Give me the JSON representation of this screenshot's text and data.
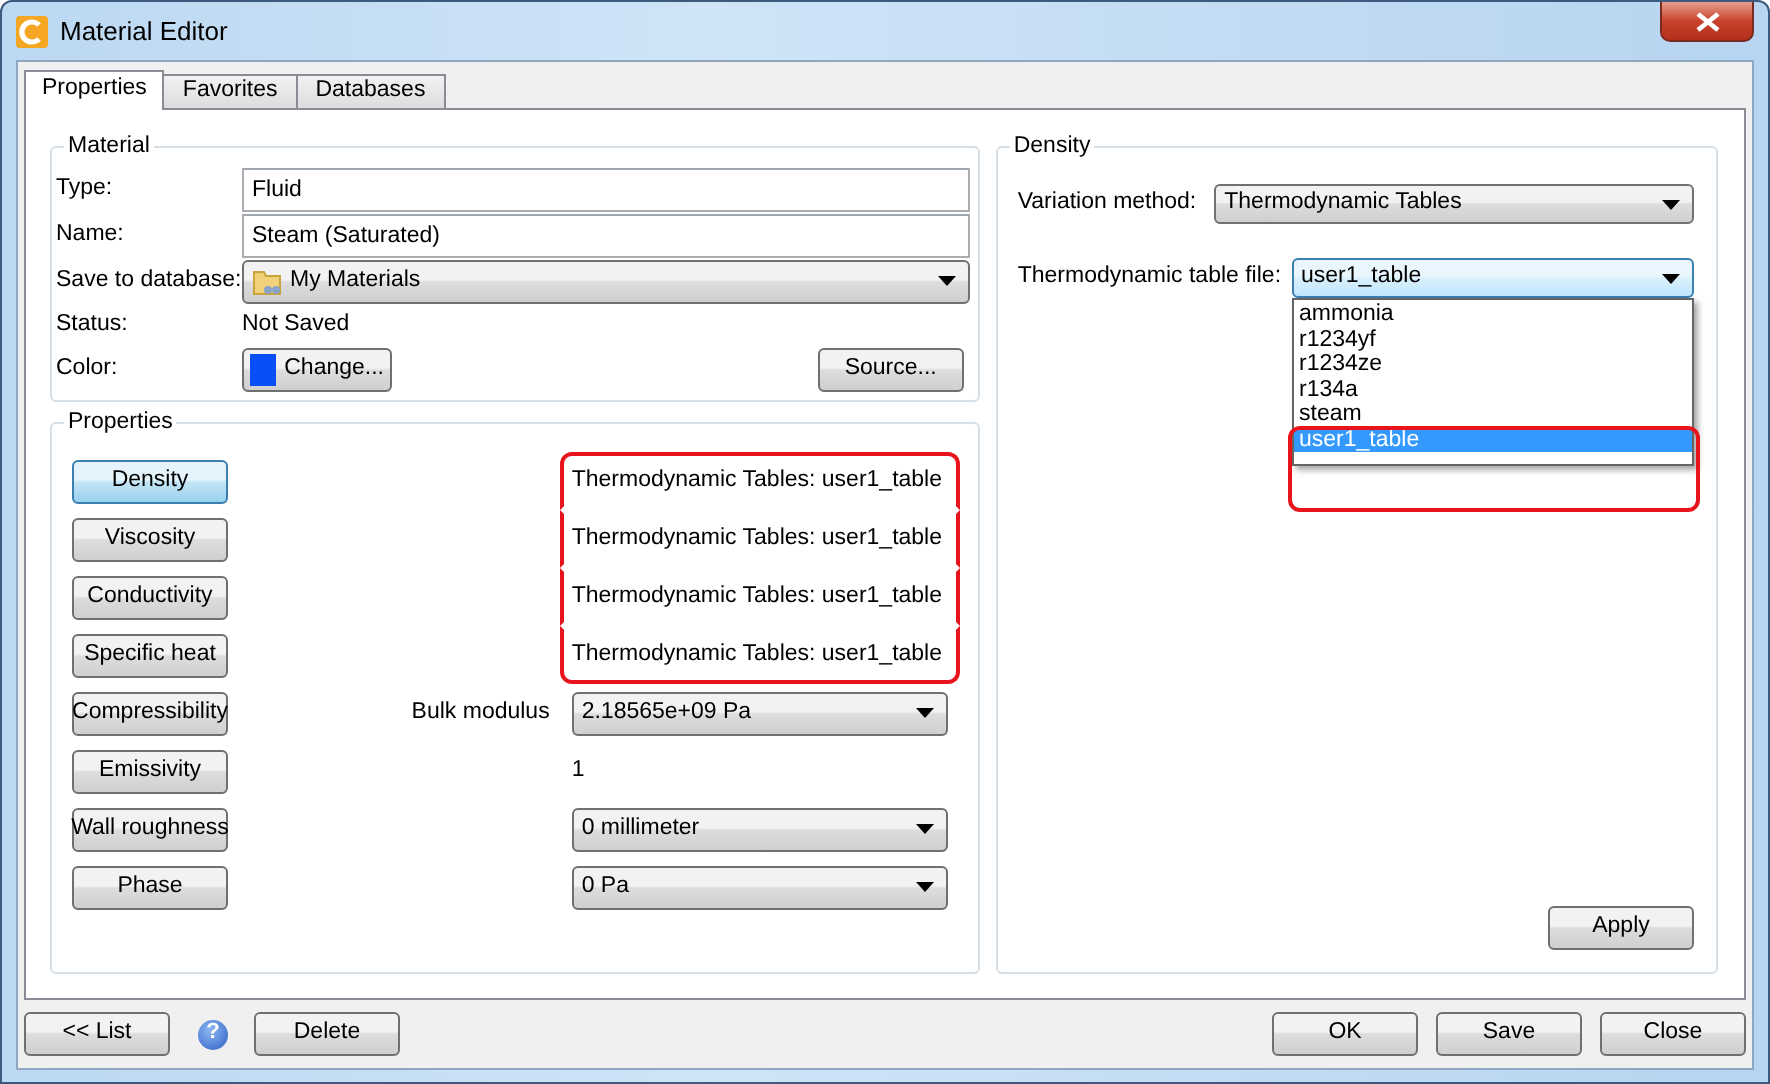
{
  "window": {
    "title": "Material Editor"
  },
  "tabs": [
    {
      "label": "Properties",
      "selected": true
    },
    {
      "label": "Favorites",
      "selected": false
    },
    {
      "label": "Databases",
      "selected": false
    }
  ],
  "material": {
    "title": "Material",
    "fields": [
      {
        "kind": "text",
        "label": "Type:",
        "value": "Fluid"
      },
      {
        "kind": "text",
        "label": "Name:",
        "value": "Steam (Saturated)"
      },
      {
        "kind": "select",
        "label": "Save to database:",
        "value": "My Materials"
      },
      {
        "kind": "static",
        "label": "Status:",
        "value": "Not Saved"
      },
      {
        "kind": "color",
        "label": "Color:",
        "value": "Change...",
        "color": "#0a4ff5",
        "extra_button": "Source..."
      }
    ]
  },
  "properties": {
    "title": "Properties",
    "rows": [
      {
        "button": "Density",
        "selected": true,
        "kind": "text",
        "value": "Thermodynamic Tables: user1_table",
        "highlighted": true
      },
      {
        "button": "Viscosity",
        "selected": false,
        "kind": "text",
        "value": "Thermodynamic Tables: user1_table",
        "highlighted": true
      },
      {
        "button": "Conductivity",
        "selected": false,
        "kind": "text",
        "value": "Thermodynamic Tables: user1_table",
        "highlighted": true
      },
      {
        "button": "Specific heat",
        "selected": false,
        "kind": "text",
        "value": "Thermodynamic Tables: user1_table",
        "highlighted": true
      },
      {
        "button": "Compressibility",
        "selected": false,
        "kind": "select",
        "label": "Bulk modulus",
        "value": "2.18565e+09 Pa",
        "highlighted": false
      },
      {
        "button": "Emissivity",
        "selected": false,
        "kind": "text",
        "value": "1",
        "highlighted": false
      },
      {
        "button": "Wall roughness",
        "selected": false,
        "kind": "select",
        "value": "0 millimeter",
        "highlighted": false
      },
      {
        "button": "Phase",
        "selected": false,
        "kind": "select",
        "value": "0 Pa",
        "highlighted": false
      }
    ]
  },
  "density": {
    "title": "Density",
    "variation_label": "Variation method:",
    "variation_value": "Thermodynamic Tables",
    "table_label": "Thermodynamic table file:",
    "table_value": "user1_table",
    "expanded": true,
    "options": [
      {
        "label": "ammonia",
        "selected": false
      },
      {
        "label": "r1234yf",
        "selected": false
      },
      {
        "label": "r1234ze",
        "selected": false
      },
      {
        "label": "r134a",
        "selected": false
      },
      {
        "label": "steam",
        "selected": false
      },
      {
        "label": "user1_table",
        "selected": true
      }
    ],
    "apply": "Apply"
  },
  "footer": {
    "left": [
      {
        "kind": "button",
        "label": "<< List"
      },
      {
        "kind": "help",
        "label": "?"
      },
      {
        "kind": "button",
        "label": "Delete"
      }
    ],
    "right": [
      {
        "kind": "button",
        "label": "OK"
      },
      {
        "kind": "button",
        "label": "Save"
      },
      {
        "kind": "button",
        "label": "Close"
      }
    ]
  }
}
